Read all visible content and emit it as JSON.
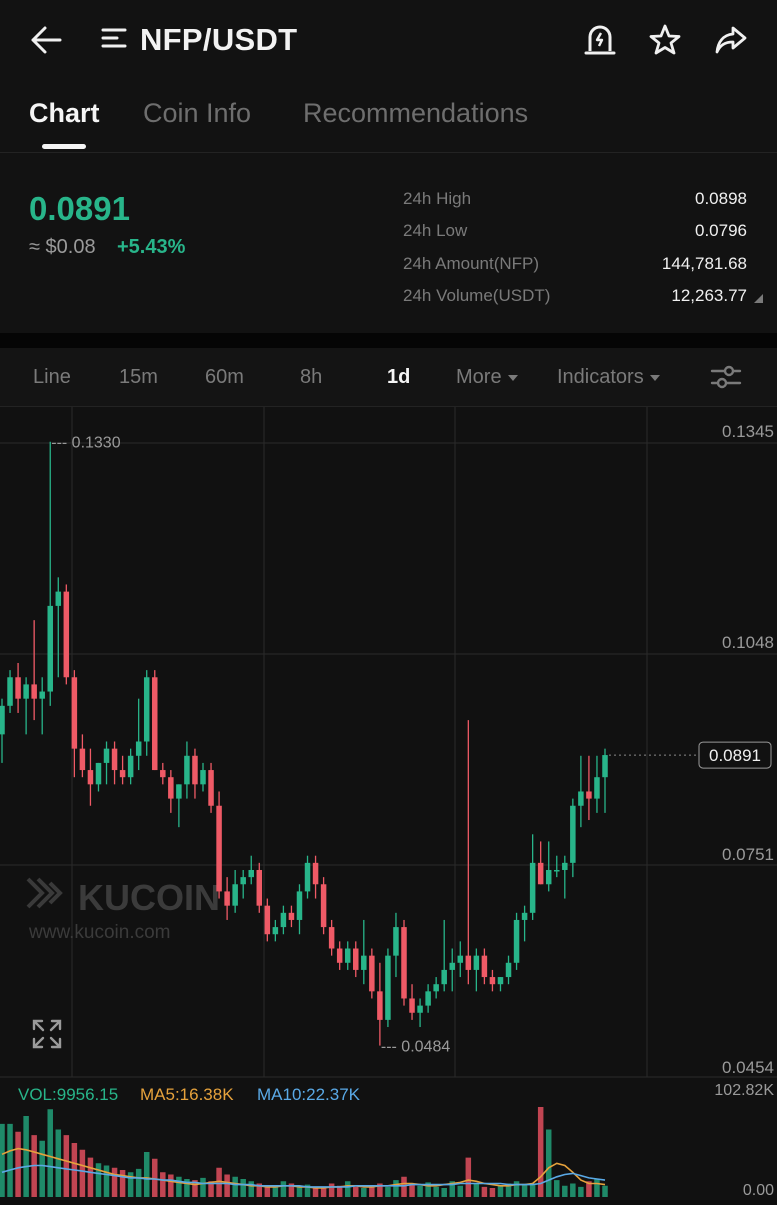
{
  "header": {
    "pair_title": "NFP/USDT",
    "icons": [
      "back-arrow-icon",
      "menu-icon",
      "price-alert-icon",
      "star-icon",
      "share-icon"
    ]
  },
  "tabs": [
    {
      "label": "Chart",
      "active": true
    },
    {
      "label": "Coin Info",
      "active": false
    },
    {
      "label": "Recommendations",
      "active": false
    }
  ],
  "ticker": {
    "price": "0.0891",
    "approx_usd": "≈ $0.08",
    "change_pct": "+5.43%",
    "stats": [
      {
        "label": "24h High",
        "value": "0.0898"
      },
      {
        "label": "24h Low",
        "value": "0.0796"
      },
      {
        "label": "24h Amount(NFP)",
        "value": "144,781.68"
      },
      {
        "label": "24h Volume(USDT)",
        "value": "12,263.77"
      }
    ]
  },
  "toolbar": {
    "timeframes": [
      {
        "label": "Line",
        "active": false
      },
      {
        "label": "15m",
        "active": false
      },
      {
        "label": "60m",
        "active": false
      },
      {
        "label": "8h",
        "active": false
      },
      {
        "label": "1d",
        "active": true
      }
    ],
    "more_label": "More",
    "indicators_label": "Indicators"
  },
  "chart_data": {
    "type": "candlestick",
    "interval": "1d",
    "y_axis_ticks": [
      "0.1345",
      "0.1048",
      "0.0751",
      "0.0454"
    ],
    "ylim": [
      0.0454,
      0.1345
    ],
    "current_price_label": "0.0891",
    "max_marker": "0.1330",
    "min_marker": "0.0484",
    "watermark": {
      "brand": "KUCOIN",
      "url": "www.kucoin.com"
    },
    "candles": [
      {
        "o": 0.092,
        "h": 0.097,
        "l": 0.088,
        "c": 0.096
      },
      {
        "o": 0.096,
        "h": 0.101,
        "l": 0.095,
        "c": 0.1
      },
      {
        "o": 0.1,
        "h": 0.102,
        "l": 0.095,
        "c": 0.097
      },
      {
        "o": 0.097,
        "h": 0.1,
        "l": 0.092,
        "c": 0.099
      },
      {
        "o": 0.099,
        "h": 0.108,
        "l": 0.094,
        "c": 0.097
      },
      {
        "o": 0.097,
        "h": 0.1,
        "l": 0.092,
        "c": 0.098
      },
      {
        "o": 0.098,
        "h": 0.133,
        "l": 0.096,
        "c": 0.11
      },
      {
        "o": 0.11,
        "h": 0.114,
        "l": 0.1,
        "c": 0.112
      },
      {
        "o": 0.112,
        "h": 0.113,
        "l": 0.099,
        "c": 0.1
      },
      {
        "o": 0.1,
        "h": 0.101,
        "l": 0.086,
        "c": 0.09
      },
      {
        "o": 0.09,
        "h": 0.092,
        "l": 0.086,
        "c": 0.087
      },
      {
        "o": 0.087,
        "h": 0.09,
        "l": 0.082,
        "c": 0.085
      },
      {
        "o": 0.085,
        "h": 0.088,
        "l": 0.084,
        "c": 0.088
      },
      {
        "o": 0.088,
        "h": 0.091,
        "l": 0.085,
        "c": 0.09
      },
      {
        "o": 0.09,
        "h": 0.091,
        "l": 0.085,
        "c": 0.087
      },
      {
        "o": 0.087,
        "h": 0.089,
        "l": 0.085,
        "c": 0.086
      },
      {
        "o": 0.086,
        "h": 0.09,
        "l": 0.085,
        "c": 0.089
      },
      {
        "o": 0.089,
        "h": 0.097,
        "l": 0.087,
        "c": 0.091
      },
      {
        "o": 0.091,
        "h": 0.101,
        "l": 0.089,
        "c": 0.1
      },
      {
        "o": 0.1,
        "h": 0.101,
        "l": 0.087,
        "c": 0.087
      },
      {
        "o": 0.087,
        "h": 0.088,
        "l": 0.085,
        "c": 0.086
      },
      {
        "o": 0.086,
        "h": 0.087,
        "l": 0.081,
        "c": 0.083
      },
      {
        "o": 0.083,
        "h": 0.085,
        "l": 0.079,
        "c": 0.085
      },
      {
        "o": 0.085,
        "h": 0.091,
        "l": 0.083,
        "c": 0.089
      },
      {
        "o": 0.089,
        "h": 0.09,
        "l": 0.083,
        "c": 0.085
      },
      {
        "o": 0.085,
        "h": 0.088,
        "l": 0.084,
        "c": 0.087
      },
      {
        "o": 0.087,
        "h": 0.088,
        "l": 0.081,
        "c": 0.082
      },
      {
        "o": 0.082,
        "h": 0.084,
        "l": 0.069,
        "c": 0.07
      },
      {
        "o": 0.07,
        "h": 0.072,
        "l": 0.066,
        "c": 0.068
      },
      {
        "o": 0.068,
        "h": 0.073,
        "l": 0.067,
        "c": 0.071
      },
      {
        "o": 0.071,
        "h": 0.073,
        "l": 0.069,
        "c": 0.072
      },
      {
        "o": 0.072,
        "h": 0.075,
        "l": 0.071,
        "c": 0.073
      },
      {
        "o": 0.073,
        "h": 0.074,
        "l": 0.067,
        "c": 0.068
      },
      {
        "o": 0.068,
        "h": 0.069,
        "l": 0.063,
        "c": 0.064
      },
      {
        "o": 0.064,
        "h": 0.066,
        "l": 0.063,
        "c": 0.065
      },
      {
        "o": 0.065,
        "h": 0.068,
        "l": 0.064,
        "c": 0.067
      },
      {
        "o": 0.067,
        "h": 0.068,
        "l": 0.065,
        "c": 0.066
      },
      {
        "o": 0.066,
        "h": 0.071,
        "l": 0.064,
        "c": 0.07
      },
      {
        "o": 0.07,
        "h": 0.075,
        "l": 0.069,
        "c": 0.074
      },
      {
        "o": 0.074,
        "h": 0.075,
        "l": 0.069,
        "c": 0.071
      },
      {
        "o": 0.071,
        "h": 0.072,
        "l": 0.064,
        "c": 0.065
      },
      {
        "o": 0.065,
        "h": 0.066,
        "l": 0.061,
        "c": 0.062
      },
      {
        "o": 0.062,
        "h": 0.063,
        "l": 0.059,
        "c": 0.06
      },
      {
        "o": 0.06,
        "h": 0.063,
        "l": 0.059,
        "c": 0.062
      },
      {
        "o": 0.062,
        "h": 0.063,
        "l": 0.058,
        "c": 0.059
      },
      {
        "o": 0.059,
        "h": 0.066,
        "l": 0.057,
        "c": 0.061
      },
      {
        "o": 0.061,
        "h": 0.062,
        "l": 0.055,
        "c": 0.056
      },
      {
        "o": 0.056,
        "h": 0.06,
        "l": 0.0484,
        "c": 0.052
      },
      {
        "o": 0.052,
        "h": 0.062,
        "l": 0.051,
        "c": 0.061
      },
      {
        "o": 0.061,
        "h": 0.067,
        "l": 0.058,
        "c": 0.065
      },
      {
        "o": 0.065,
        "h": 0.066,
        "l": 0.054,
        "c": 0.055
      },
      {
        "o": 0.055,
        "h": 0.057,
        "l": 0.052,
        "c": 0.053
      },
      {
        "o": 0.053,
        "h": 0.055,
        "l": 0.051,
        "c": 0.054
      },
      {
        "o": 0.054,
        "h": 0.057,
        "l": 0.053,
        "c": 0.056
      },
      {
        "o": 0.056,
        "h": 0.058,
        "l": 0.055,
        "c": 0.057
      },
      {
        "o": 0.057,
        "h": 0.066,
        "l": 0.056,
        "c": 0.059
      },
      {
        "o": 0.059,
        "h": 0.062,
        "l": 0.056,
        "c": 0.06
      },
      {
        "o": 0.06,
        "h": 0.063,
        "l": 0.058,
        "c": 0.061
      },
      {
        "o": 0.061,
        "h": 0.094,
        "l": 0.057,
        "c": 0.059
      },
      {
        "o": 0.059,
        "h": 0.062,
        "l": 0.056,
        "c": 0.061
      },
      {
        "o": 0.061,
        "h": 0.062,
        "l": 0.057,
        "c": 0.058
      },
      {
        "o": 0.058,
        "h": 0.059,
        "l": 0.056,
        "c": 0.057
      },
      {
        "o": 0.057,
        "h": 0.058,
        "l": 0.056,
        "c": 0.058
      },
      {
        "o": 0.058,
        "h": 0.061,
        "l": 0.057,
        "c": 0.06
      },
      {
        "o": 0.06,
        "h": 0.067,
        "l": 0.059,
        "c": 0.066
      },
      {
        "o": 0.066,
        "h": 0.068,
        "l": 0.063,
        "c": 0.067
      },
      {
        "o": 0.067,
        "h": 0.078,
        "l": 0.066,
        "c": 0.074
      },
      {
        "o": 0.074,
        "h": 0.077,
        "l": 0.071,
        "c": 0.071
      },
      {
        "o": 0.071,
        "h": 0.077,
        "l": 0.07,
        "c": 0.073
      },
      {
        "o": 0.073,
        "h": 0.075,
        "l": 0.072,
        "c": 0.073
      },
      {
        "o": 0.073,
        "h": 0.075,
        "l": 0.069,
        "c": 0.074
      },
      {
        "o": 0.074,
        "h": 0.083,
        "l": 0.072,
        "c": 0.082
      },
      {
        "o": 0.082,
        "h": 0.089,
        "l": 0.079,
        "c": 0.084
      },
      {
        "o": 0.084,
        "h": 0.089,
        "l": 0.08,
        "c": 0.083
      },
      {
        "o": 0.083,
        "h": 0.089,
        "l": 0.081,
        "c": 0.086
      },
      {
        "o": 0.086,
        "h": 0.09,
        "l": 0.081,
        "c": 0.0891
      }
    ],
    "volume_panel": {
      "vol_label": "VOL:9956.15",
      "ma5_label": "MA5:16.38K",
      "ma10_label": "MA10:22.37K",
      "y_max_label": "102.82K",
      "y_min_label": "0.00",
      "ylim": [
        0,
        102820
      ],
      "volumes": [
        65,
        65,
        58,
        72,
        55,
        50,
        78,
        60,
        55,
        48,
        42,
        35,
        30,
        28,
        26,
        24,
        22,
        25,
        40,
        34,
        22,
        20,
        18,
        16,
        15,
        17,
        14,
        26,
        20,
        18,
        16,
        14,
        12,
        10,
        9,
        14,
        12,
        10,
        11,
        9,
        8,
        12,
        10,
        14,
        9,
        8,
        10,
        12,
        9,
        15,
        18,
        12,
        10,
        13,
        9,
        8,
        14,
        10,
        35,
        12,
        9,
        8,
        10,
        12,
        14,
        11,
        12,
        85,
        60,
        15,
        10,
        12,
        9,
        14,
        16,
        10
      ],
      "ma5": [
        38,
        41,
        43,
        42,
        40,
        38,
        36,
        34,
        32,
        30,
        28,
        26,
        24,
        22,
        20,
        19,
        18,
        17,
        17,
        16,
        15,
        14,
        13,
        12,
        11,
        12,
        13,
        14,
        13,
        12,
        11,
        10,
        10,
        9,
        9,
        10,
        10,
        9,
        9,
        8,
        8,
        9,
        9,
        10,
        10,
        9,
        9,
        10,
        10,
        11,
        12,
        12,
        11,
        10,
        10,
        11,
        12,
        13,
        15,
        14,
        12,
        11,
        10,
        10,
        11,
        11,
        12,
        18,
        26,
        30,
        28,
        22,
        15,
        12,
        12,
        11
      ],
      "ma10": [
        22,
        24,
        26,
        27,
        28,
        28,
        27,
        26,
        25,
        24,
        23,
        22,
        21,
        20,
        19,
        18,
        17,
        17,
        16,
        16,
        15,
        15,
        14,
        13,
        13,
        12,
        12,
        12,
        12,
        11,
        11,
        11,
        10,
        10,
        10,
        10,
        10,
        10,
        9,
        9,
        9,
        9,
        9,
        9,
        10,
        10,
        10,
        10,
        10,
        10,
        10,
        11,
        11,
        11,
        11,
        11,
        11,
        12,
        12,
        12,
        12,
        12,
        12,
        11,
        11,
        11,
        11,
        12,
        15,
        18,
        20,
        21,
        19,
        17,
        16,
        15
      ]
    }
  }
}
